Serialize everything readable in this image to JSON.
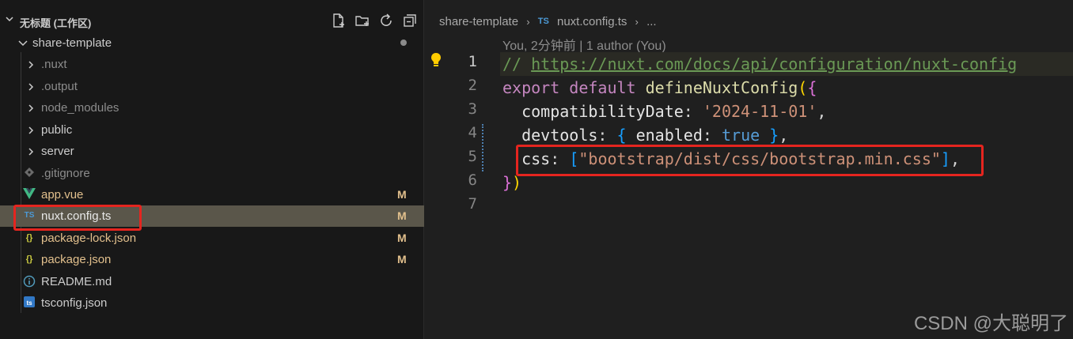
{
  "explorer": {
    "title": "无标题 (工作区)",
    "project": "share-template",
    "icons": [
      "new-file-icon",
      "new-folder-icon",
      "refresh-icon",
      "collapse-all-icon"
    ],
    "items": [
      {
        "label": ".nuxt",
        "kind": "folder",
        "badge": ""
      },
      {
        "label": ".output",
        "kind": "folder",
        "badge": ""
      },
      {
        "label": "node_modules",
        "kind": "folder",
        "badge": ""
      },
      {
        "label": "public",
        "kind": "folder",
        "badge": ""
      },
      {
        "label": "server",
        "kind": "folder",
        "badge": ""
      },
      {
        "label": ".gitignore",
        "kind": "file",
        "icon": "git-icon",
        "badge": ""
      },
      {
        "label": "app.vue",
        "kind": "file",
        "icon": "vue-icon",
        "badge": "M"
      },
      {
        "label": "nuxt.config.ts",
        "kind": "file",
        "icon": "TS",
        "badge": "M"
      },
      {
        "label": "package-lock.json",
        "kind": "file",
        "icon": "{}",
        "badge": "M"
      },
      {
        "label": "package.json",
        "kind": "file",
        "icon": "{}",
        "badge": "M"
      },
      {
        "label": "README.md",
        "kind": "file",
        "icon": "info-icon",
        "badge": ""
      },
      {
        "label": "tsconfig.json",
        "kind": "file",
        "icon": "ts",
        "badge": ""
      }
    ]
  },
  "editor": {
    "breadcrumb": {
      "folder": "share-template",
      "file_icon": "TS",
      "file": "nuxt.config.ts",
      "tail": "..."
    },
    "blame": "You, 2分钟前 | 1 author (You)",
    "line_numbers": [
      "1",
      "2",
      "3",
      "4",
      "5",
      "6",
      "7"
    ],
    "code": {
      "l1_comment": "// ",
      "l1_link": "https://nuxt.com/docs/api/configuration/nuxt-config",
      "l2_export": "export",
      "l2_default": "default",
      "l2_func": "defineNuxtConfig",
      "l2_paren": "(",
      "l2_brace": "{",
      "l3_prop": "compatibilityDate",
      "l3_colon": ": ",
      "l3_value": "'2024-11-01'",
      "l3_comma": ",",
      "l4_prop": "devtools",
      "l4_colon": ": ",
      "l4_open": "{",
      "l4_key": " enabled",
      "l4_colon2": ": ",
      "l4_value": "true",
      "l4_close": " }",
      "l4_comma": ",",
      "l5_prop": "css",
      "l5_colon": ": ",
      "l5_open": "[",
      "l5_value": "\"bootstrap/dist/css/bootstrap.min.css\"",
      "l5_close": "]",
      "l5_comma": ",",
      "l6_brace": "}",
      "l6_paren": ")"
    }
  },
  "watermark": "CSDN @大聪明了",
  "colors": {
    "highlight": "#e5251f",
    "modified": "#e2c08d",
    "ts_blue": "#4c9ad6"
  }
}
